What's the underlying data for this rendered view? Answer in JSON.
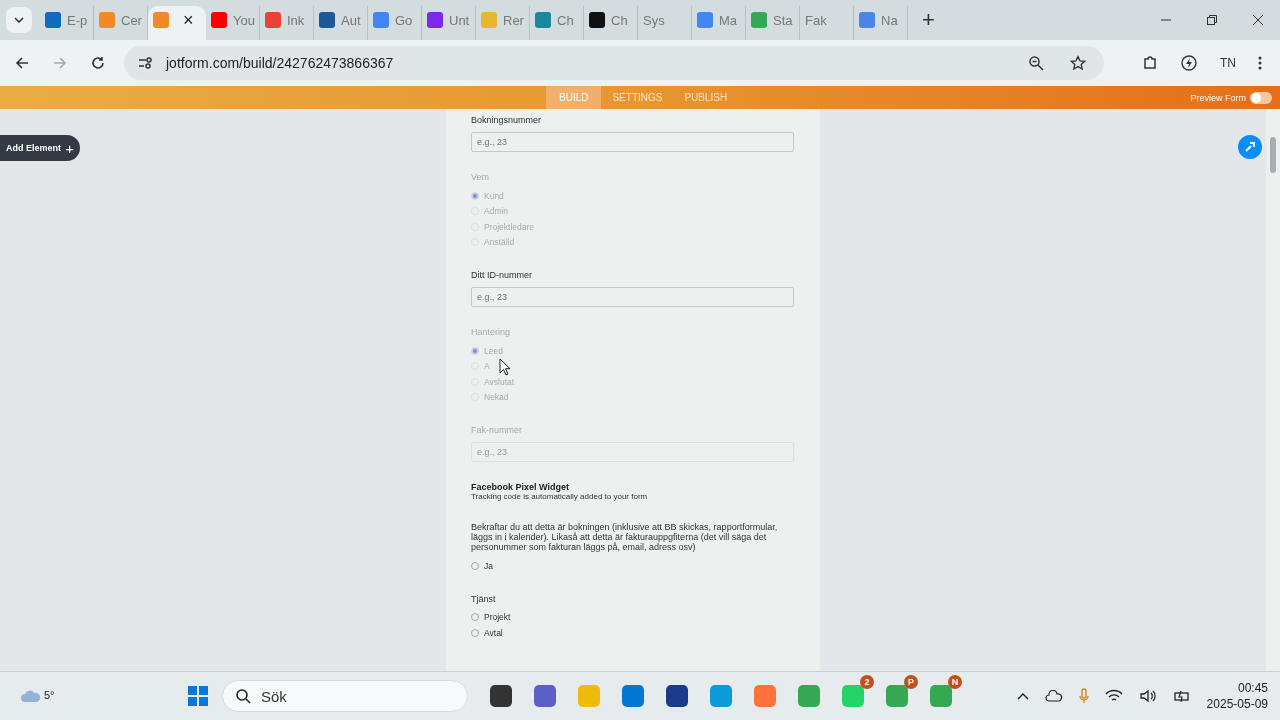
{
  "browser": {
    "tabs": [
      {
        "label": "E-p",
        "color": "#0f6cbd",
        "selected": false
      },
      {
        "label": "Cer",
        "color": "#f08a24",
        "selected": false
      },
      {
        "color": "#f08a24",
        "selected": true,
        "close": "×"
      },
      {
        "label": "You",
        "color": "#ff0000",
        "selected": false
      },
      {
        "label": "Ink",
        "color": "#ea4335",
        "selected": false
      },
      {
        "label": "Aut",
        "color": "#1b5a96",
        "selected": false
      },
      {
        "label": "Go",
        "color": "#4285f4",
        "selected": false
      },
      {
        "label": "Unt",
        "color": "#7d2ae8",
        "selected": false
      },
      {
        "label": "Rer",
        "color": "#e8b730",
        "selected": false
      },
      {
        "label": "Ch",
        "color": "#1a8a9a",
        "selected": false
      },
      {
        "label": "Ch",
        "color": "#111111",
        "selected": false
      },
      {
        "label": "Sys",
        "selected": false
      },
      {
        "label": "Ma",
        "color": "#4285f4",
        "selected": false
      },
      {
        "label": "Sta",
        "color": "#34a853",
        "selected": false
      },
      {
        "label": "Fak",
        "selected": false
      },
      {
        "label": "Na",
        "color": "#4a86e8",
        "selected": false
      }
    ],
    "new_tab": "+",
    "url": "jotform.com/build/242762473866367",
    "profile": "TN"
  },
  "builder": {
    "tabs": [
      {
        "label": "BUILD",
        "selected": true
      },
      {
        "label": "SETTINGS",
        "selected": false
      },
      {
        "label": "PUBLISH",
        "selected": false
      }
    ],
    "preview": {
      "label": "Preview Form",
      "on": false
    },
    "add_element": {
      "label": "Add Element",
      "icon": "+"
    }
  },
  "form": [
    {
      "kind": "text",
      "label": "Bokningsnummer",
      "placeholder": "e.g., 23",
      "disabled": false
    },
    {
      "kind": "radio",
      "label": "Vem",
      "disabled": true,
      "options": [
        {
          "label": "Kund",
          "selected": true
        },
        {
          "label": "Admin",
          "selected": false
        },
        {
          "label": "Projektledare",
          "selected": false
        },
        {
          "label": "Anställd",
          "selected": false
        }
      ]
    },
    {
      "kind": "text",
      "label": "Ditt ID-nummer",
      "placeholder": "e.g., 23",
      "disabled": false
    },
    {
      "kind": "radio",
      "label": "Hantering",
      "disabled": true,
      "options": [
        {
          "label": "Leed",
          "selected": true
        },
        {
          "label": "A",
          "selected": false
        },
        {
          "label": "Avslutat",
          "selected": false
        },
        {
          "label": "Nekad",
          "selected": false
        }
      ]
    },
    {
      "kind": "text",
      "label": "Fak-nummer",
      "placeholder": "e.g., 23",
      "disabled": true
    },
    {
      "kind": "widget",
      "label": "Facebook Pixel Widget",
      "text": "Tracking code is automatically added to your form"
    },
    {
      "kind": "radio",
      "label": "Bekraftar du att detta är bokningen (inklusive att BB skickas, rapportformular, läggs in i kalender). Likaså att detta är fakturauppgfiterna (det vill säga det personummer som fakturan läggs på, email, adress osv)",
      "disabled": false,
      "options": [
        {
          "label": "Ja",
          "selected": false
        }
      ]
    },
    {
      "kind": "radio",
      "label": "Tjänst",
      "disabled": false,
      "options": [
        {
          "label": "Projekt",
          "selected": false
        },
        {
          "label": "Avtal",
          "selected": false
        }
      ]
    }
  ],
  "taskbar": {
    "weather": "5°",
    "search": "Sök",
    "apps": [
      {
        "color": "#333333"
      },
      {
        "color": "#5b5fc7"
      },
      {
        "color": "#f2b90f"
      },
      {
        "color": "#0078d4"
      },
      {
        "color": "#1b3a8c"
      },
      {
        "color": "#0c9bd8"
      },
      {
        "color": "#ff7139"
      },
      {
        "color": "#34a853"
      },
      {
        "color": "#25d366",
        "badge": "2"
      },
      {
        "color": "#34a853",
        "badge": "P"
      },
      {
        "color": "#34a853",
        "badge": "N"
      }
    ],
    "time": "00:45",
    "date": "2025-05-09"
  }
}
